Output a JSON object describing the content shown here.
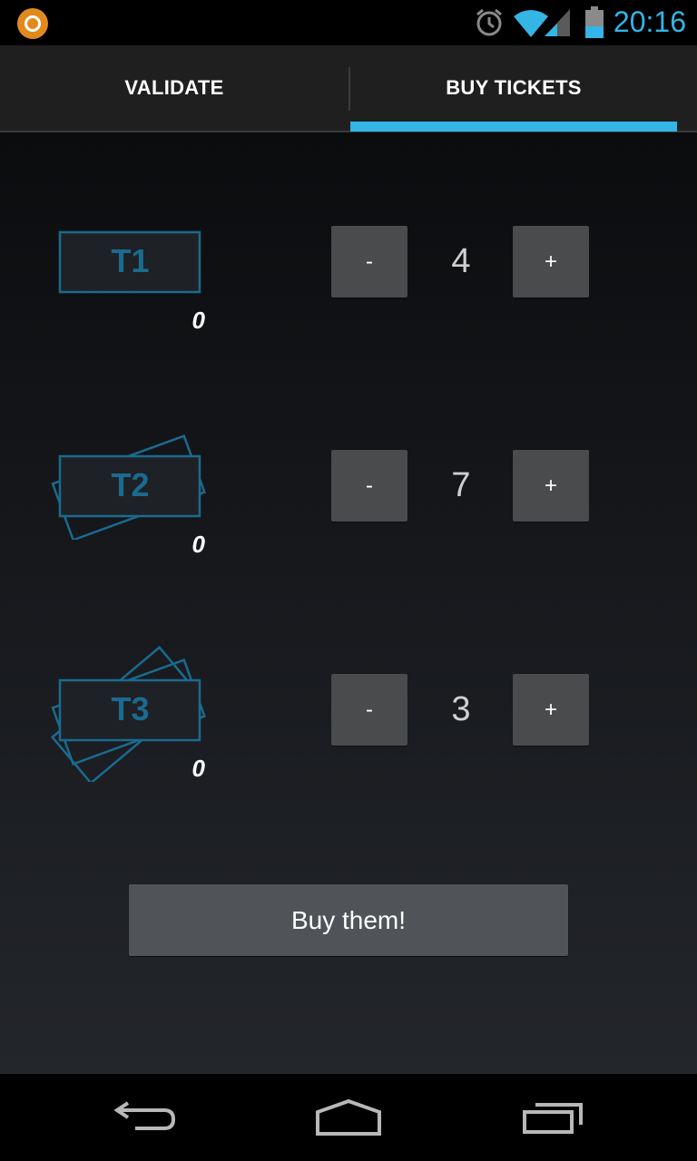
{
  "status_bar": {
    "time": "20:16",
    "icons": [
      "app-notification-icon",
      "alarm-icon",
      "wifi-icon",
      "cell-signal-icon",
      "battery-icon"
    ],
    "accent_color": "#33b5e5"
  },
  "tabs": [
    {
      "label": "VALIDATE",
      "selected": false
    },
    {
      "label": "BUY TICKETS",
      "selected": true
    }
  ],
  "tickets": [
    {
      "name": "T1",
      "owned": "0",
      "quantity": "4",
      "minus_label": "-",
      "plus_label": "+"
    },
    {
      "name": "T2",
      "owned": "0",
      "quantity": "7",
      "minus_label": "-",
      "plus_label": "+"
    },
    {
      "name": "T3",
      "owned": "0",
      "quantity": "3",
      "minus_label": "-",
      "plus_label": "+"
    }
  ],
  "buy_button_label": "Buy them!",
  "nav_bar": {
    "icons": [
      "back-icon",
      "home-icon",
      "recent-apps-icon"
    ]
  }
}
